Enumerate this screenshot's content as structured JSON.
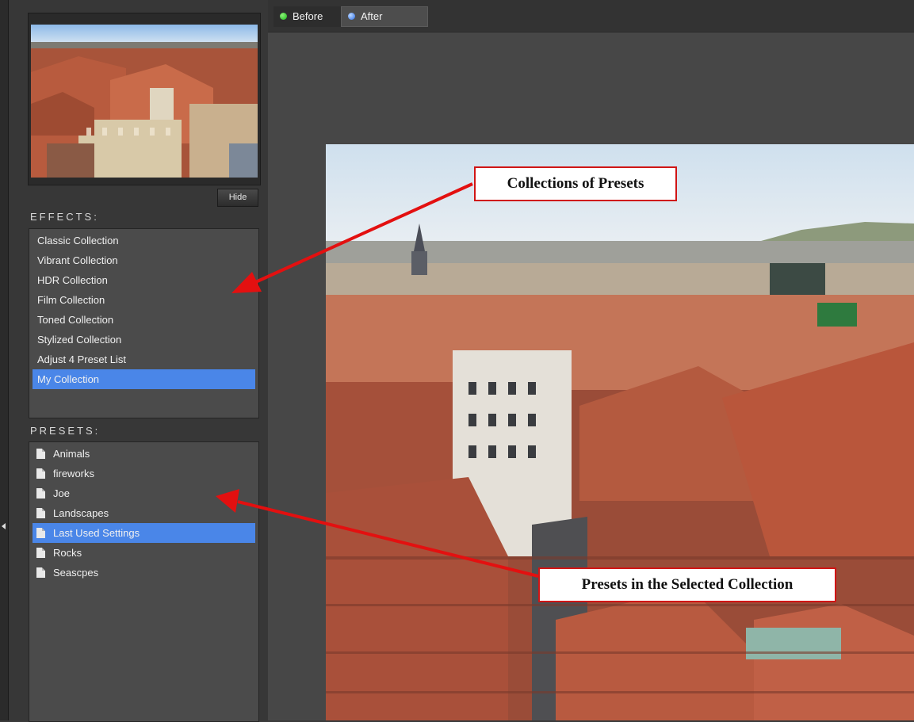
{
  "tabs": {
    "before": "Before",
    "after": "After"
  },
  "thumbnail": {
    "hide_label": "Hide"
  },
  "effects": {
    "label": "EFFECTS:",
    "items": [
      {
        "label": "Classic Collection"
      },
      {
        "label": "Vibrant Collection"
      },
      {
        "label": "HDR Collection"
      },
      {
        "label": "Film Collection"
      },
      {
        "label": "Toned Collection"
      },
      {
        "label": "Stylized Collection"
      },
      {
        "label": "Adjust 4 Preset List"
      },
      {
        "label": "My Collection",
        "selected": true
      }
    ]
  },
  "presets": {
    "label": "PRESETS:",
    "items": [
      {
        "label": "Animals"
      },
      {
        "label": "fireworks"
      },
      {
        "label": "Joe"
      },
      {
        "label": "Landscapes"
      },
      {
        "label": "Last Used Settings",
        "selected": true
      },
      {
        "label": "Rocks"
      },
      {
        "label": "Seascpes"
      }
    ]
  },
  "annotations": {
    "collections": "Collections of Presets",
    "presets": "Presets in the Selected Collection"
  },
  "colors": {
    "selection": "#4a86e8",
    "annotation_border": "#d01515",
    "arrow": "#e31010"
  }
}
